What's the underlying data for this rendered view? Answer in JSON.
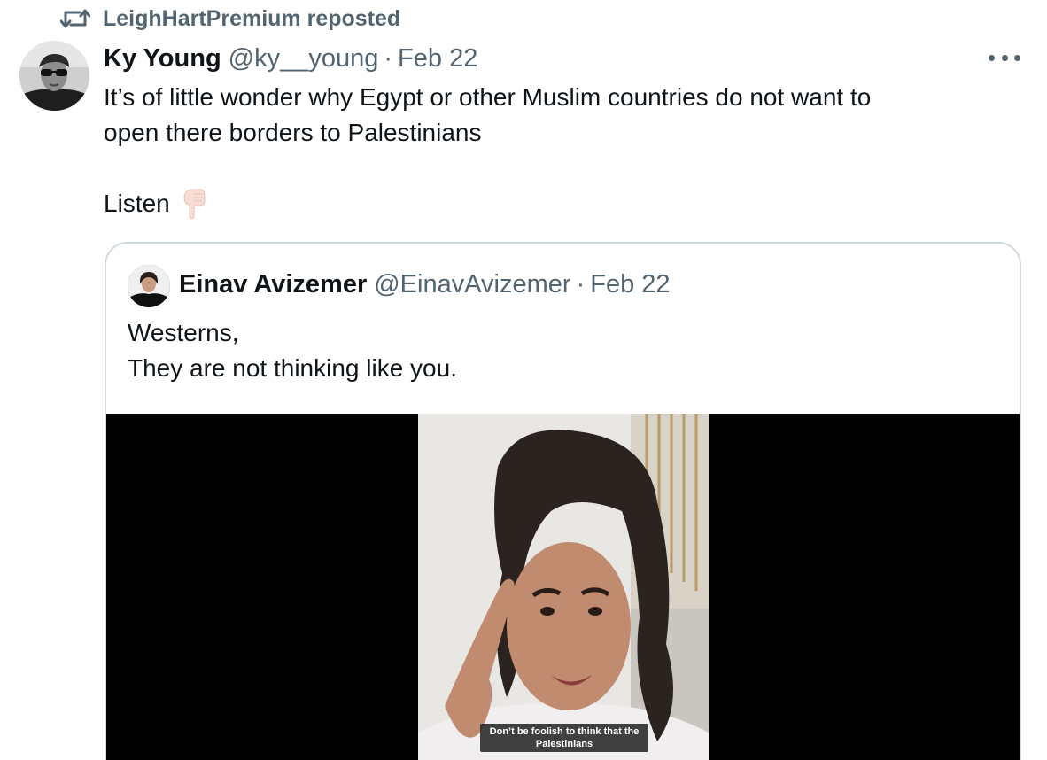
{
  "repost": {
    "icon": "repost-icon",
    "label": "LeighHartPremium reposted"
  },
  "tweet": {
    "author_name": "Ky Young",
    "author_handle": "@ky__young",
    "separator": "·",
    "date": "Feb 22",
    "more_icon": "more-icon",
    "text_line1": "It’s of little wonder why Egypt or other Muslim countries do not want to",
    "text_line2": "open there borders to Palestinians",
    "text_line3": "Listen",
    "emoji": "pointing-down-emoji"
  },
  "quoted": {
    "author_name": "Einav Avizemer",
    "author_handle": "@EinavAvizemer",
    "separator": "·",
    "date": "Feb 22",
    "text_line1": "Westerns,",
    "text_line2": "They are not thinking like you.",
    "video_caption_line1": "Don’t be foolish to think that the",
    "video_caption_line2": "Palestinians"
  },
  "colors": {
    "text_primary": "#0f1419",
    "text_secondary": "#536471",
    "border": "#cfd9de",
    "video_bg": "#000000"
  }
}
